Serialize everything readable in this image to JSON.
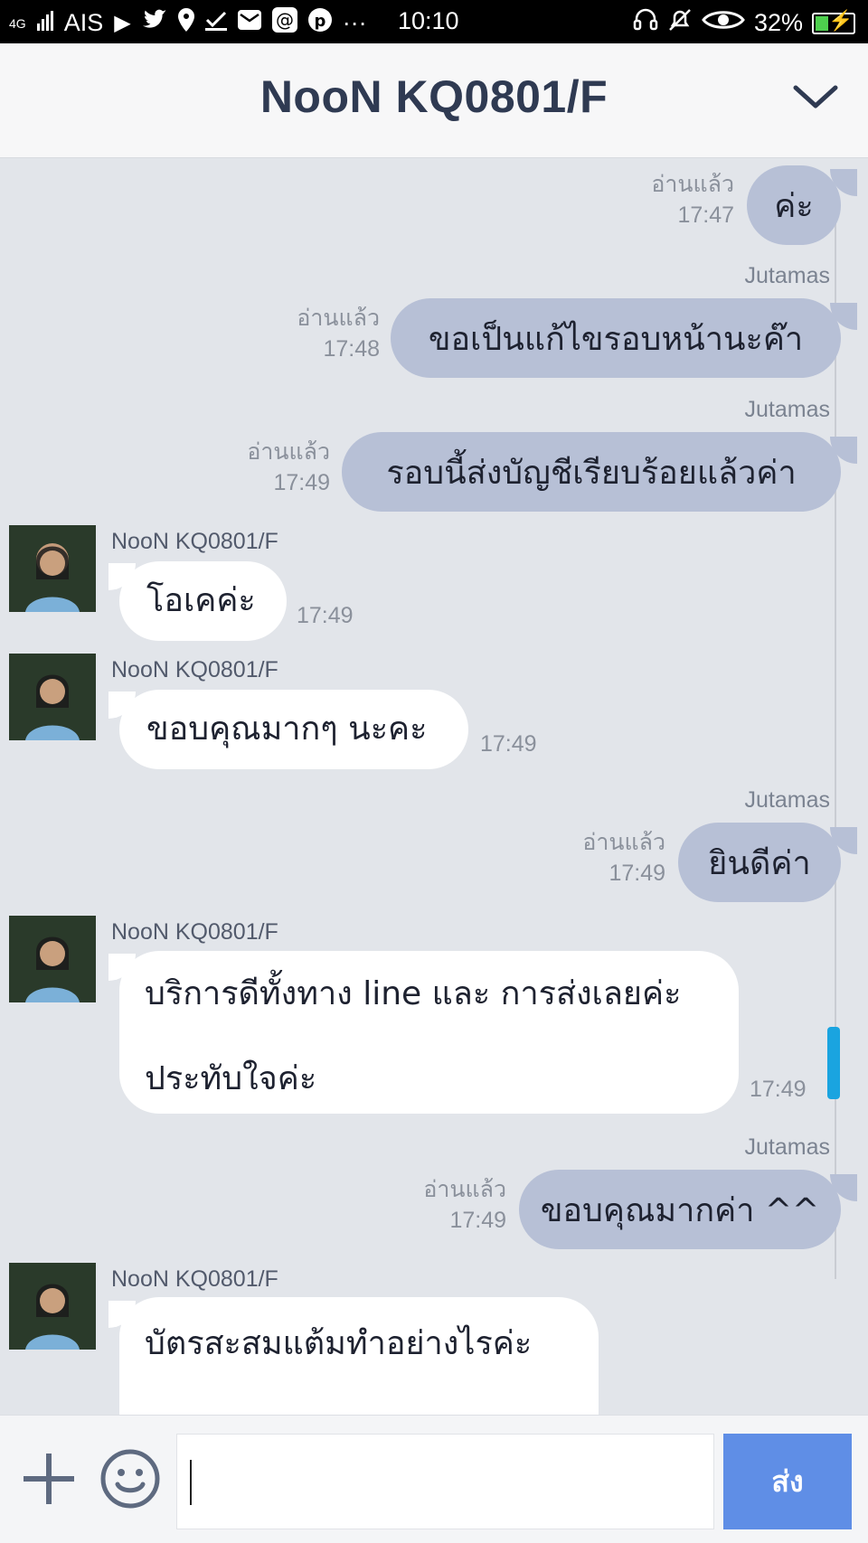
{
  "status_bar": {
    "network": "4G",
    "carrier": "AIS",
    "time": "10:10",
    "battery": "32%",
    "icons": [
      "play-store-icon",
      "twitter-icon",
      "location-icon",
      "check-icon",
      "mail-icon",
      "at-icon",
      "pinterest-icon",
      "more-icon"
    ],
    "right_icons": [
      "headset-icon",
      "bell-muted-icon",
      "eye-icon",
      "battery-charging-icon"
    ]
  },
  "header": {
    "title": "NooN KQ0801/F"
  },
  "messages": {
    "m1": {
      "read": "อ่านแล้ว",
      "time": "17:47",
      "text": "ค่ะ"
    },
    "m2": {
      "sender": "Jutamas",
      "read": "อ่านแล้ว",
      "time": "17:48",
      "text": "ขอเป็นแก้ไขรอบหน้านะค๊า"
    },
    "m3": {
      "sender": "Jutamas",
      "read": "อ่านแล้ว",
      "time": "17:49",
      "text": "รอบนี้ส่งบัญชีเรียบร้อยแล้วค่า"
    },
    "m4": {
      "sender": "NooN KQ0801/F",
      "time": "17:49",
      "text": "โอเคค่ะ"
    },
    "m5": {
      "sender": "NooN KQ0801/F",
      "time": "17:49",
      "text": "ขอบคุณมากๆ นะคะ"
    },
    "m6": {
      "sender": "Jutamas",
      "read": "อ่านแล้ว",
      "time": "17:49",
      "text": "ยินดีค่า"
    },
    "m7": {
      "sender": "NooN KQ0801/F",
      "time": "17:49",
      "line1": "บริการดีทั้งทาง line และ การส่งเลยค่ะ",
      "line2": "ประทับใจค่ะ"
    },
    "m8": {
      "sender": "Jutamas",
      "read": "อ่านแล้ว",
      "time": "17:49",
      "text": "ขอบคุณมากค่า ^^"
    },
    "m9": {
      "sender": "NooN KQ0801/F",
      "line1": "บัตรสะสมแต้มทำอย่างไรค่ะ"
    }
  },
  "input_bar": {
    "placeholder": "",
    "send_label": "ส่ง"
  },
  "colors": {
    "bubble_mine": "#b7c0d6",
    "bubble_theirs": "#ffffff",
    "send_button": "#5f8ee6",
    "background": "#e2e5ea"
  }
}
